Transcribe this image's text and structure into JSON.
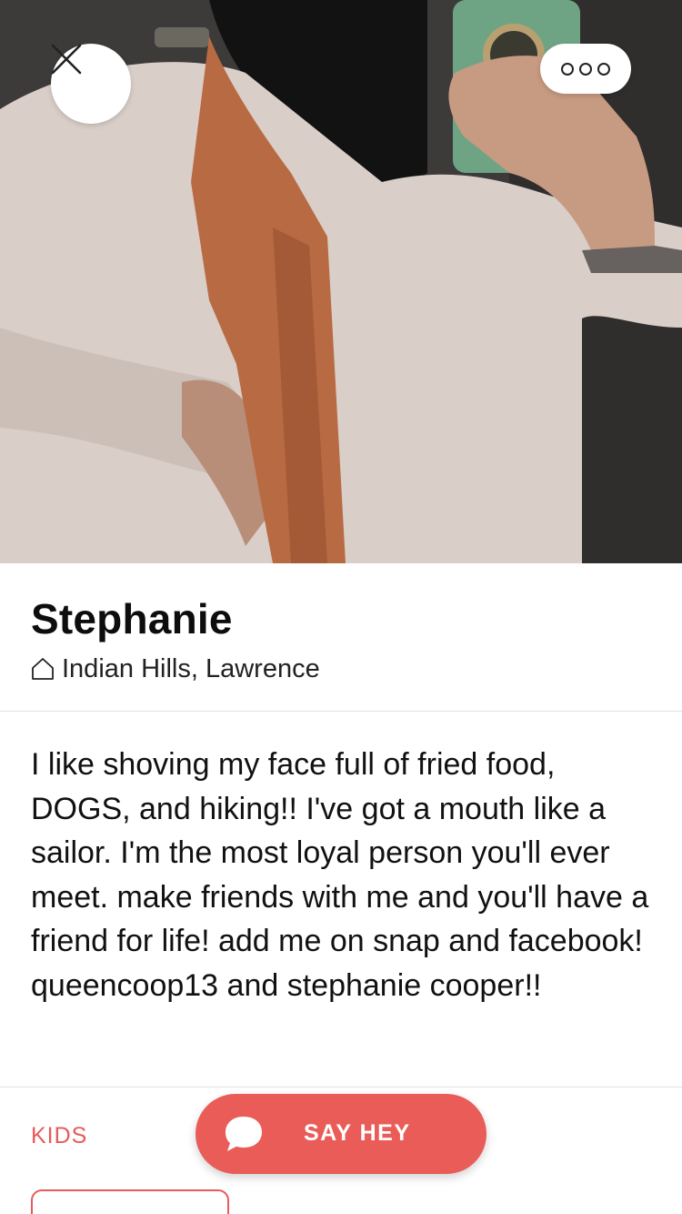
{
  "profile": {
    "name": "Stephanie",
    "location": "Indian Hills, Lawrence",
    "bio": "I like shoving my face full of fried food, DOGS, and hiking!! I've got a mouth like a sailor. I'm the most loyal person you'll ever meet. make friends with me and you'll have a friend for life! add me on snap and facebook! queencoop13 and stephanie cooper!!"
  },
  "sections": {
    "kids_label": "KIDS"
  },
  "actions": {
    "say_hey_label": "SAY HEY"
  },
  "icons": {
    "close": "close-icon",
    "more": "more-options-icon",
    "home": "home-icon",
    "chat": "chat-bubble-icon"
  },
  "colors": {
    "accent": "#ea5c58",
    "text": "#111111",
    "divider": "#e3e3e3"
  }
}
